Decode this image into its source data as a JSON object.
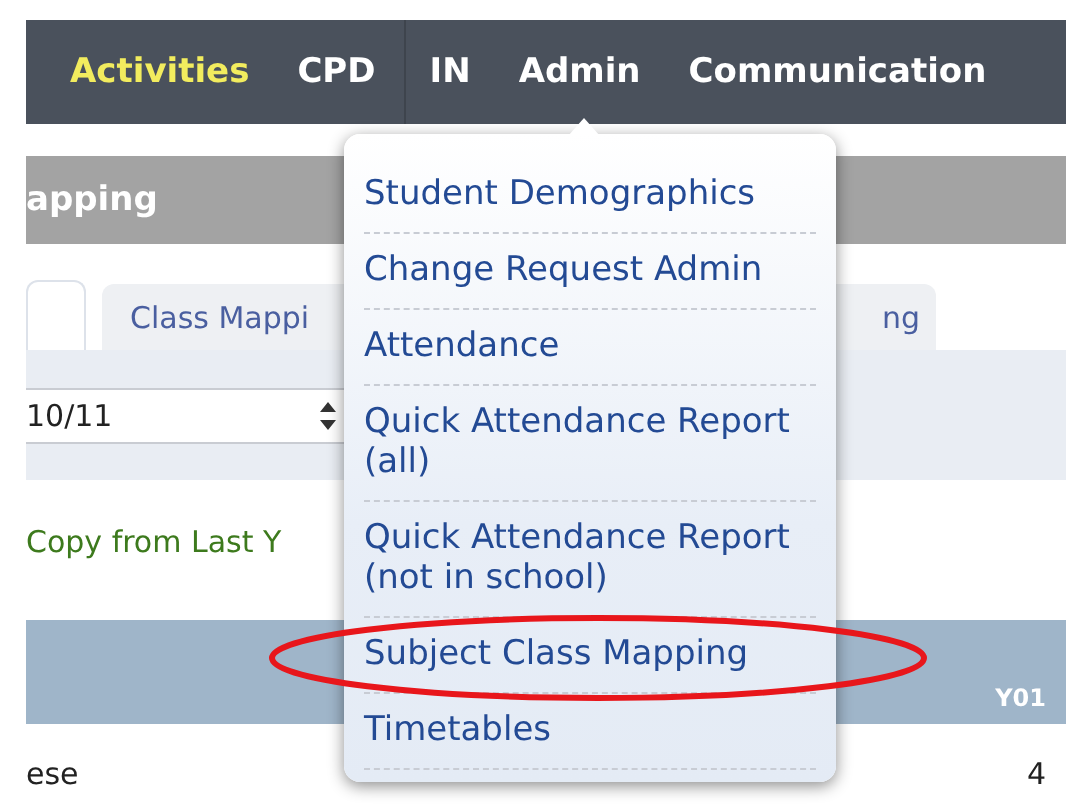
{
  "nav": [
    {
      "label": "Activities",
      "selected": true
    },
    {
      "label": "CPD",
      "selected": false
    },
    {
      "label": "IN",
      "selected": false
    },
    {
      "label": "Admin",
      "selected": false
    },
    {
      "label": "Communication",
      "selected": false
    }
  ],
  "page_title": "apping",
  "tabs": [
    {
      "selected": true
    },
    {
      "label": "Class Mappi",
      "selected": false
    },
    {
      "label": "ng",
      "selected": false
    }
  ],
  "year_select": {
    "value": "10/11"
  },
  "copy_link": "Copy from Last Y",
  "table": {
    "columns": [
      "Y01"
    ],
    "rows": [
      {
        "name": "ese",
        "value": "4"
      }
    ]
  },
  "menu": {
    "items": [
      {
        "label": "Student Demographics",
        "circled": false
      },
      {
        "label": "Change Request Admin",
        "circled": false
      },
      {
        "label": "Attendance",
        "circled": false
      },
      {
        "label": "Quick Attendance Report (all)",
        "circled": false
      },
      {
        "label": "Quick Attendance Report (not in school)",
        "circled": false
      },
      {
        "label": "Subject Class Mapping",
        "circled": true
      },
      {
        "label": "Timetables",
        "circled": false
      }
    ]
  }
}
